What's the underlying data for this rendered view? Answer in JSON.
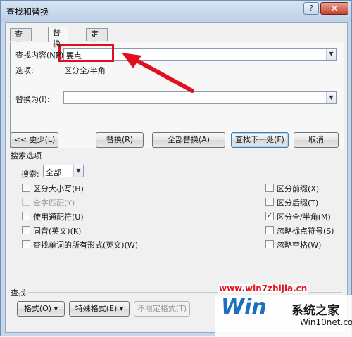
{
  "window": {
    "title": "查找和替换",
    "help_glyph": "?",
    "close_glyph": "✕"
  },
  "tabs": [
    {
      "label": "查找(D)"
    },
    {
      "label": "替换(P)"
    },
    {
      "label": "定位(G)"
    }
  ],
  "find": {
    "label": "查找内容(N):",
    "value": "要点",
    "options_label": "选项:",
    "options_value": "区分全/半角"
  },
  "replace": {
    "label": "替换为(I):",
    "value": ""
  },
  "buttons": {
    "less": "<< 更少(L)",
    "replace": "替换(R)",
    "replace_all": "全部替换(A)",
    "find_next": "查找下一处(F)",
    "cancel": "取消",
    "format": "格式(O) ▾",
    "special": "特殊格式(E) ▾",
    "no_format": "不限定格式(T)"
  },
  "search_options": {
    "group_label": "搜索选项",
    "search_label": "搜索:",
    "search_value": "全部",
    "left": [
      {
        "label": "区分大小写(H)",
        "checked": false,
        "enabled": true
      },
      {
        "label": "全字匹配(Y)",
        "checked": false,
        "enabled": false
      },
      {
        "label": "使用通配符(U)",
        "checked": false,
        "enabled": true
      },
      {
        "label": "同音(英文)(K)",
        "checked": false,
        "enabled": true
      },
      {
        "label": "查找单词的所有形式(英文)(W)",
        "checked": false,
        "enabled": true
      }
    ],
    "right": [
      {
        "label": "区分前缀(X)",
        "checked": false,
        "enabled": true
      },
      {
        "label": "区分后缀(T)",
        "checked": false,
        "enabled": true
      },
      {
        "label": "区分全/半角(M)",
        "checked": true,
        "enabled": true
      },
      {
        "label": "忽略标点符号(S)",
        "checked": false,
        "enabled": true
      },
      {
        "label": "忽略空格(W)",
        "checked": false,
        "enabled": true
      }
    ]
  },
  "find_section": {
    "label": "查找"
  },
  "watermark": {
    "url": "www.win7zhijia.cn",
    "logo_text": "Win",
    "brand": "系统之家",
    "site": "Win10net.com"
  },
  "colors": {
    "annotation_red": "#e0101e",
    "title_bar": "#c6d7ea"
  }
}
